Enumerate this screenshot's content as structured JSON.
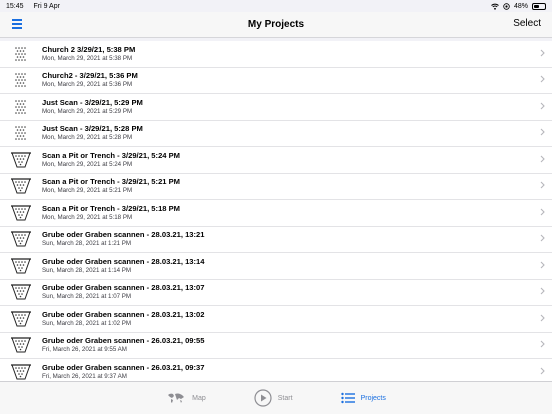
{
  "status": {
    "time": "15:45",
    "date": "Fri 9 Apr",
    "battery_percent": "48%",
    "battery_level": 0.48
  },
  "nav": {
    "title": "My Projects",
    "select_label": "Select",
    "menu_icon": "hamburger-icon"
  },
  "rows": [
    {
      "title": "Church 2 3/29/21, 5:38 PM",
      "subtitle": "Mon, March 29, 2021 at 5:38 PM",
      "icon": "dot-grid-icon"
    },
    {
      "title": "Church2 - 3/29/21, 5:36 PM",
      "subtitle": "Mon, March 29, 2021 at 5:36 PM",
      "icon": "dot-grid-icon"
    },
    {
      "title": "Just Scan - 3/29/21, 5:29 PM",
      "subtitle": "Mon, March 29, 2021 at 5:29 PM",
      "icon": "dot-grid-icon"
    },
    {
      "title": "Just Scan - 3/29/21, 5:28 PM",
      "subtitle": "Mon, March 29, 2021 at 5:28 PM",
      "icon": "dot-grid-icon"
    },
    {
      "title": "Scan a Pit or Trench - 3/29/21, 5:24 PM",
      "subtitle": "Mon, March 29, 2021 at 5:24 PM",
      "icon": "pit-icon"
    },
    {
      "title": "Scan a Pit or Trench - 3/29/21, 5:21 PM",
      "subtitle": "Mon, March 29, 2021 at 5:21 PM",
      "icon": "pit-icon"
    },
    {
      "title": "Scan a Pit or Trench - 3/29/21, 5:18 PM",
      "subtitle": "Mon, March 29, 2021 at 5:18 PM",
      "icon": "pit-icon"
    },
    {
      "title": "Grube oder Graben scannen - 28.03.21, 13:21",
      "subtitle": "Sun, March 28, 2021 at 1:21 PM",
      "icon": "pit-icon"
    },
    {
      "title": "Grube oder Graben scannen - 28.03.21, 13:14",
      "subtitle": "Sun, March 28, 2021 at 1:14 PM",
      "icon": "pit-icon"
    },
    {
      "title": "Grube oder Graben scannen - 28.03.21, 13:07",
      "subtitle": "Sun, March 28, 2021 at 1:07 PM",
      "icon": "pit-icon"
    },
    {
      "title": "Grube oder Graben scannen - 28.03.21, 13:02",
      "subtitle": "Sun, March 28, 2021 at 1:02 PM",
      "icon": "pit-icon"
    },
    {
      "title": "Grube oder Graben scannen - 26.03.21, 09:55",
      "subtitle": "Fri, March 26, 2021 at 9:55 AM",
      "icon": "pit-icon"
    },
    {
      "title": "Grube oder Graben scannen - 26.03.21, 09:37",
      "subtitle": "Fri, March 26, 2021 at 9:37 AM",
      "icon": "pit-icon"
    }
  ],
  "tabs": [
    {
      "label": "Map",
      "icon": "world-map-icon",
      "active": false
    },
    {
      "label": "Start",
      "icon": "play-circle-icon",
      "active": false
    },
    {
      "label": "Projects",
      "icon": "list-icon",
      "active": true
    }
  ],
  "colors": {
    "accent": "#1a6fe0",
    "inactive": "#8e8e93",
    "background": "#f2f2f7"
  }
}
